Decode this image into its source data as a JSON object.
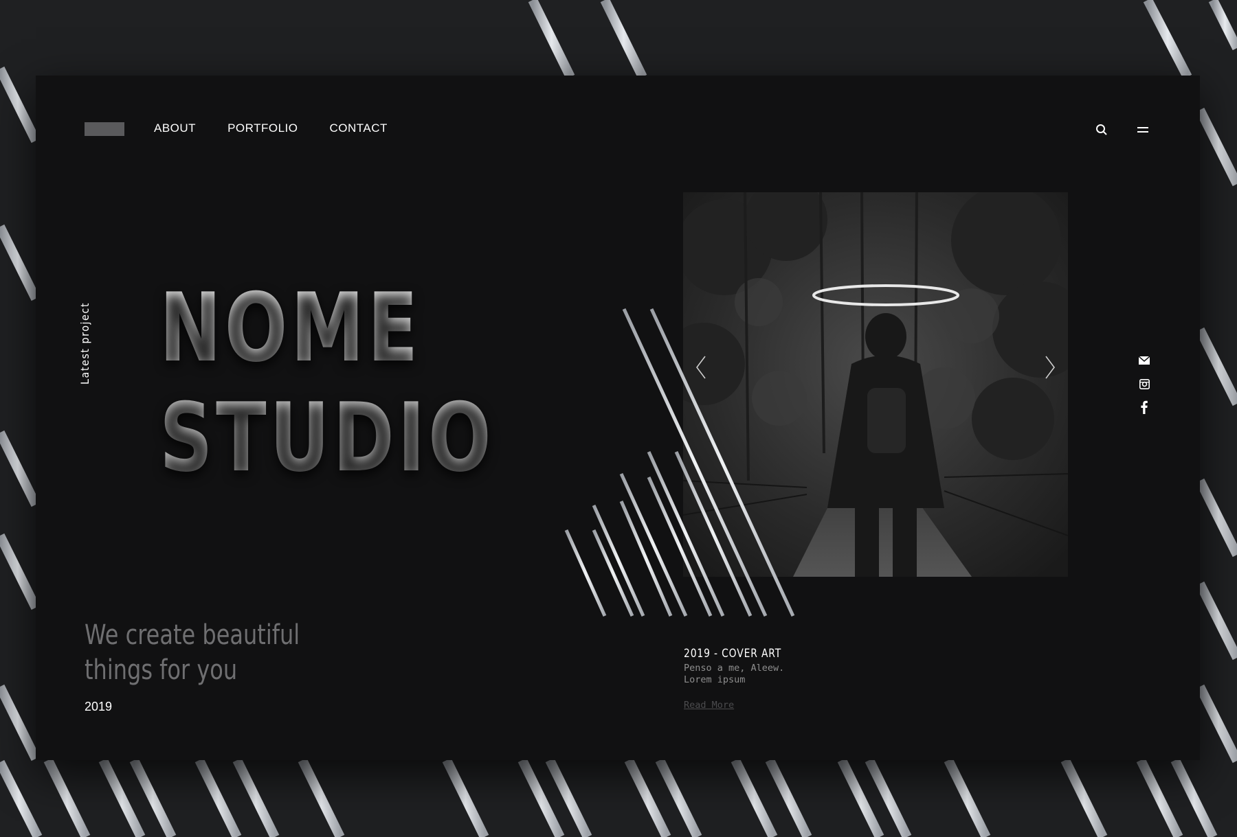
{
  "nav": {
    "items": [
      {
        "label": "ABOUT"
      },
      {
        "label": "PORTFOLIO"
      },
      {
        "label": "CONTACT"
      }
    ]
  },
  "header": {
    "icons": [
      "search-icon",
      "menu-icon"
    ]
  },
  "side_label": "Latest project",
  "hero": {
    "line1": "NOME",
    "line2": "STUDIO"
  },
  "tagline": {
    "line1": "We create beautiful",
    "line2": "things for you"
  },
  "year": "2019",
  "project": {
    "title": "2019 - COVER ART",
    "desc_line1": "Penso a me, Aleew.",
    "desc_line2": "Lorem ipsum",
    "read_more": "Read More"
  },
  "socials": [
    "mail-icon",
    "instagram-icon",
    "facebook-icon"
  ],
  "colors": {
    "background": "#1f2022",
    "card": "#111112",
    "accent": "#c9c9c9",
    "muted_text": "#6f6f71"
  }
}
